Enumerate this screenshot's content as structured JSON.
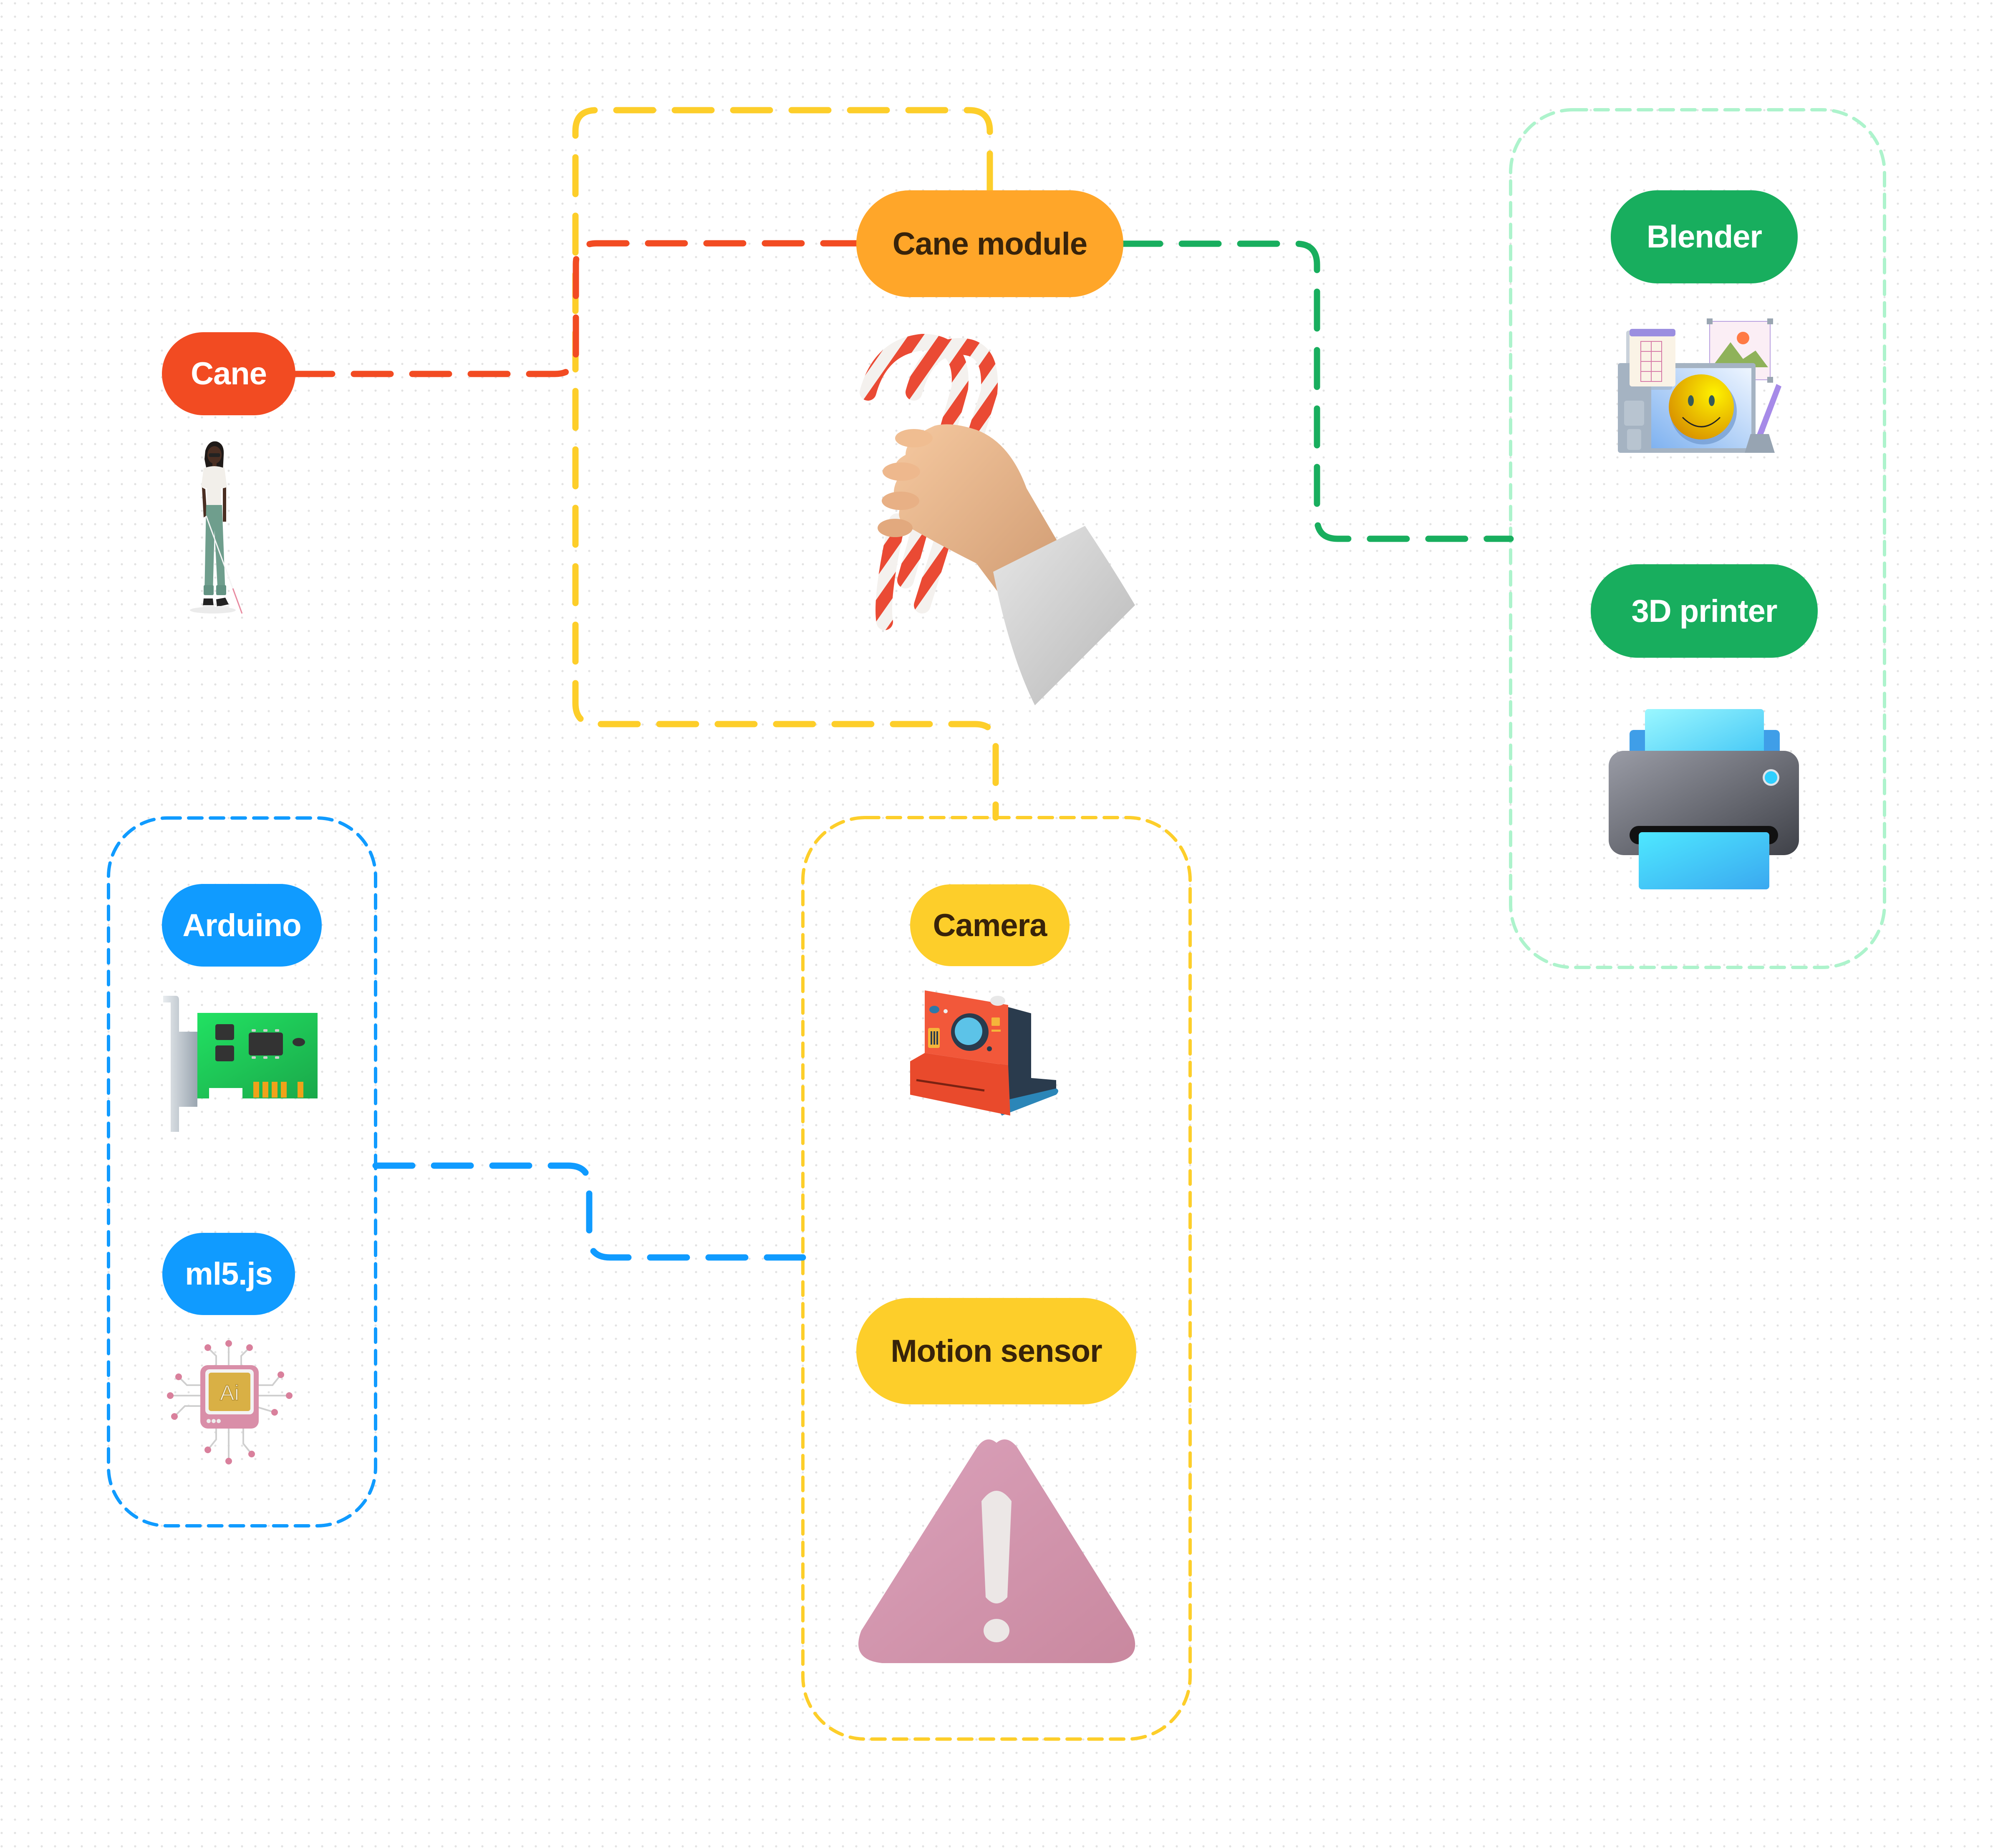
{
  "canvas": {
    "background": "#ffffff",
    "dot_color": "#e2e2e2"
  },
  "colors": {
    "red": "#f24b22",
    "orange": "#ffa629",
    "yellow": "#fdce2a",
    "green": "#18ae5e",
    "light_green": "#adf3cc",
    "blue": "#109bff",
    "dark_text": "#38230a",
    "white_text": "#ffffff"
  },
  "nodes": {
    "cane": {
      "label": "Cane",
      "color": "red",
      "icon": "person-with-white-cane-icon"
    },
    "cane_module": {
      "label": "Cane module",
      "color": "orange",
      "icon": "hand-holding-candy-cane-icon"
    },
    "blender": {
      "label": "Blender",
      "color": "green",
      "icon": "design-tablet-icon",
      "group": "fabrication"
    },
    "printer_3d": {
      "label": "3D printer",
      "color": "green",
      "icon": "printer-icon",
      "group": "fabrication"
    },
    "arduino": {
      "label": "Arduino",
      "color": "blue",
      "icon": "circuit-board-icon",
      "group": "software-hardware"
    },
    "ml5js": {
      "label": "ml5.js",
      "color": "blue",
      "icon": "ai-chip-icon",
      "group": "software-hardware"
    },
    "camera": {
      "label": "Camera",
      "color": "yellow",
      "icon": "instant-camera-icon",
      "group": "sensors"
    },
    "motion_sensor": {
      "label": "Motion sensor",
      "color": "yellow",
      "icon": "warning-triangle-icon",
      "group": "sensors"
    }
  },
  "groups": [
    {
      "id": "fabrication",
      "color": "light_green",
      "members": [
        "blender",
        "printer_3d"
      ]
    },
    {
      "id": "software-hardware",
      "color": "blue",
      "members": [
        "arduino",
        "ml5js"
      ]
    },
    {
      "id": "sensors",
      "color": "yellow",
      "members": [
        "camera",
        "motion_sensor"
      ]
    }
  ],
  "connections": [
    {
      "from": "cane",
      "to": "cane_module",
      "color": "red",
      "style": "dashed"
    },
    {
      "from": "cane_module",
      "to": "sensors",
      "color": "yellow",
      "style": "dashed"
    },
    {
      "from": "cane_module",
      "to": "fabrication",
      "color": "green",
      "style": "dashed"
    },
    {
      "from": "software-hardware",
      "to": "sensors",
      "color": "blue",
      "style": "dashed"
    }
  ]
}
